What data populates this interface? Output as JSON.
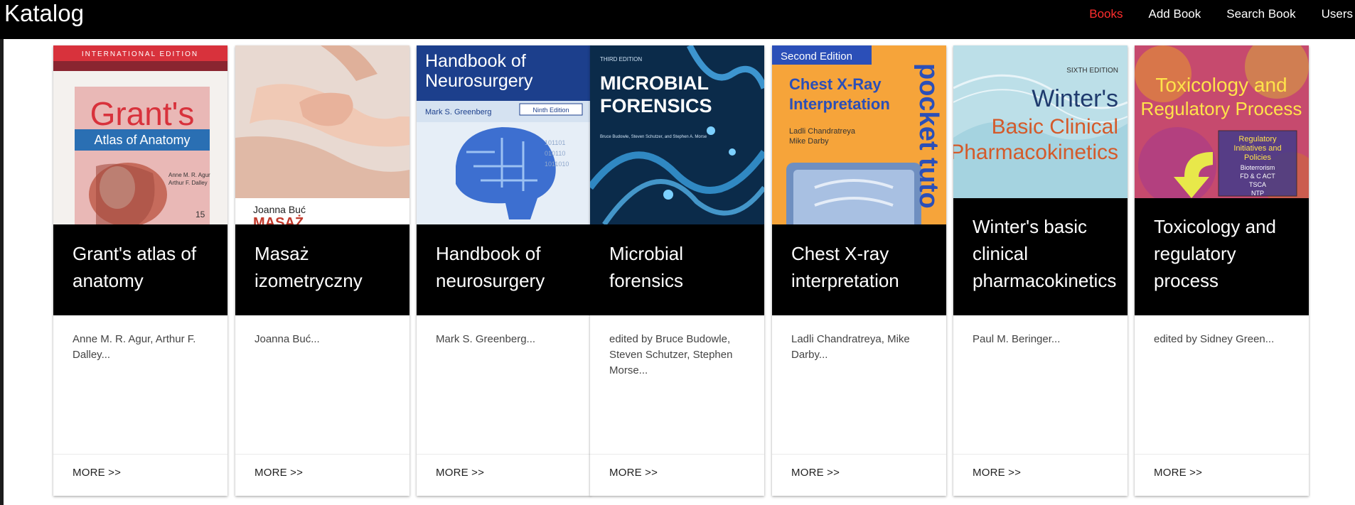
{
  "app": {
    "title": "Katalog"
  },
  "nav": {
    "items": [
      {
        "label": "Books",
        "active": true
      },
      {
        "label": "Add Book"
      },
      {
        "label": "Search Book"
      },
      {
        "label": "Users"
      }
    ]
  },
  "books": [
    {
      "title": "Grant's atlas of anatomy",
      "authors": "Anne M. R. Agur, Arthur F. Dalley...",
      "more": "MORE >>",
      "cover_text": {
        "edition": "INTERNATIONAL EDITION",
        "title1": "Grant's",
        "title2": "Atlas of Anatomy",
        "authors": "Anne M. R. Agur\nArthur F. Dalley",
        "ed_num": "15"
      }
    },
    {
      "title": "Masaż izometryczny",
      "authors": "Joanna Buć...",
      "more": "MORE >>",
      "cover_text": {
        "author": "Joanna Buć",
        "title": "MASAŻ"
      }
    },
    {
      "title": "Handbook of neurosurgery",
      "authors": "Mark S. Greenberg...",
      "more": "MORE >>",
      "cover_text": {
        "title1": "Handbook of",
        "title2": "Neurosurgery",
        "author": "Mark S. Greenberg",
        "edition": "Ninth Edition"
      }
    },
    {
      "title": "Microbial forensics",
      "authors": "edited by Bruce Budowle, Steven Schutzer, Stephen Morse...",
      "more": "MORE >>",
      "cover_text": {
        "edition": "THIRD EDITION",
        "title1": "MICROBIAL",
        "title2": "FORENSICS",
        "editors": "Bruce Budowle, Steven Schutzer, and Stephen A. Morse"
      }
    },
    {
      "title": "Chest X-ray interpretation",
      "authors": "Ladli Chandratreya, Mike Darby...",
      "more": "MORE >>",
      "cover_text": {
        "edition": "Second Edition",
        "title1": "Chest X-Ray",
        "title2": "Interpretation",
        "author1": "Ladli Chandratreya",
        "author2": "Mike Darby",
        "series": "pocket tuto"
      }
    },
    {
      "title": "Winter's basic clinical pharmacokinetics",
      "authors": "Paul M. Beringer...",
      "more": "MORE >>",
      "cover_text": {
        "edition": "SIXTH EDITION",
        "title1": "Winter's",
        "title2": "Basic Clinical",
        "title3": "Pharmacokinetics"
      }
    },
    {
      "title": "Toxicology and regulatory process",
      "authors": "edited by Sidney Green...",
      "more": "MORE >>",
      "cover_text": {
        "title1": "Toxicology and",
        "title2": "Regulatory Process",
        "box1": "Regulatory",
        "box2": "Initiatives and",
        "box3": "Policies",
        "box4": "Bioterrorism",
        "box5": "FD & C ACT",
        "box6": "TSCA",
        "box7": "NTP"
      }
    }
  ],
  "colors": {
    "active_nav": "#ff2d2d",
    "topbar": "#000000",
    "title_box": "#000000"
  }
}
